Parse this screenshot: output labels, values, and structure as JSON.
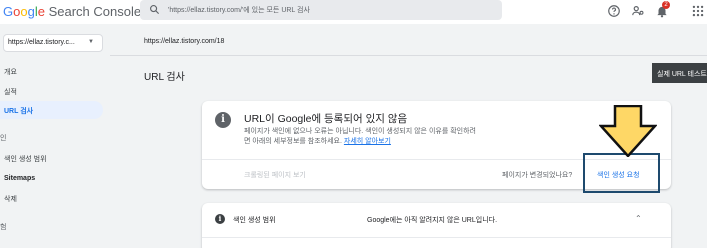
{
  "header": {
    "logo_google": [
      "G",
      "o",
      "o",
      "g",
      "l",
      "e"
    ],
    "logo_product": " Search Console",
    "search_placeholder": "'https://ellaz.tistory.com/'에 있는 모든 URL 검사",
    "notification_count": "2"
  },
  "sidebar": {
    "property": "https://ellaz.tistory.c...",
    "items": [
      {
        "label": "개요"
      },
      {
        "label": "실적"
      },
      {
        "label": "URL 검사"
      },
      {
        "label": "인"
      },
      {
        "label": "색인 생성 범위"
      },
      {
        "label": "Sitemaps"
      },
      {
        "label": "삭제"
      },
      {
        "label": "험"
      }
    ]
  },
  "main": {
    "url": "https://ellaz.tistory.com/18",
    "page_title": "URL 검사",
    "live_test_button": "실제 URL 테스트",
    "status_card": {
      "title": "URL이 Google에 등록되어 있지 않음",
      "desc_line1": "페이지가 색인에 없으나 오류는 아닙니다. 색인이 생성되지 않은 이유를 확인하려",
      "desc_line2": "면 아래의 세부정보를 참조하세요.",
      "desc_link": "자세히 알아보기",
      "crawled_button": "크롤링된 페이지 보기",
      "changed_text": "페이지가 변경되었나요?",
      "request_button": "색인 생성 요청"
    },
    "coverage_card": {
      "title": "색인 생성 범위",
      "status": "Google에는 아직 알려지지 않은 URL입니다."
    }
  },
  "colors": {
    "accent": "#1a73e8",
    "arrow_fill": "#fed766",
    "highlight_border": "#1e4a6e"
  }
}
